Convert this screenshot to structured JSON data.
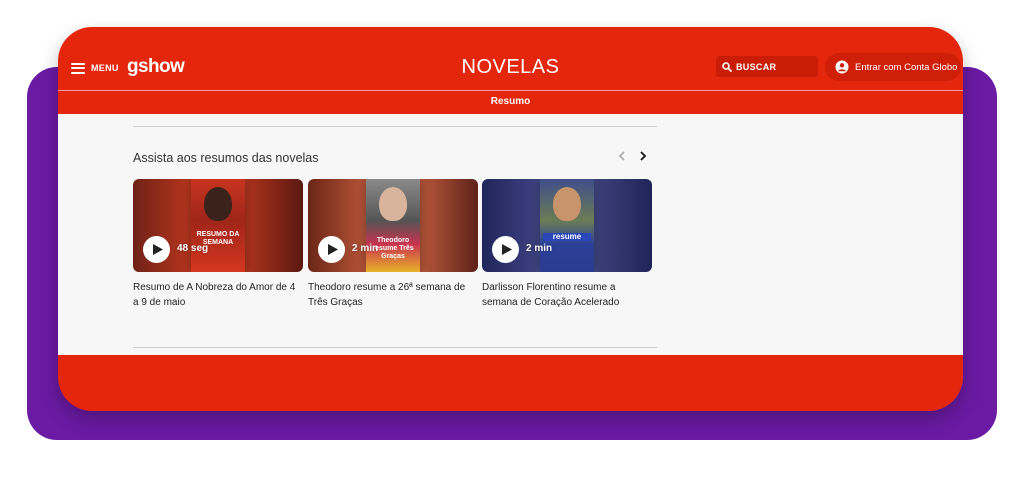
{
  "header": {
    "menu_label": "MENU",
    "logo": "gshow",
    "title": "NOVELAS",
    "search_label": "BUSCAR",
    "login_label": "Entrar com Conta Globo"
  },
  "subnav": {
    "link": "Resumo"
  },
  "section": {
    "title": "Assista aos resumos das novelas",
    "cards": [
      {
        "duration": "48 seg",
        "caption": "Resumo de A Nobreza do Amor de 4 a 9 de maio",
        "overlay": "RESUMO DA SEMANA"
      },
      {
        "duration": "2 min",
        "caption": "Theodoro resume a 26ª semana de Três Graças",
        "overlay": "Theodoro resume Três Graças"
      },
      {
        "duration": "2 min",
        "caption": "Darlisson Florentino resume a semana de Coração Acelerado",
        "overlay": "resume"
      }
    ]
  },
  "colors": {
    "brand_red": "#e4260d",
    "purple_frame": "#6a1aa3",
    "content_bg": "#f7f7f7"
  },
  "icons": [
    "hamburger-icon",
    "search-icon",
    "user-icon",
    "chevron-left-icon",
    "chevron-right-icon",
    "play-icon"
  ]
}
